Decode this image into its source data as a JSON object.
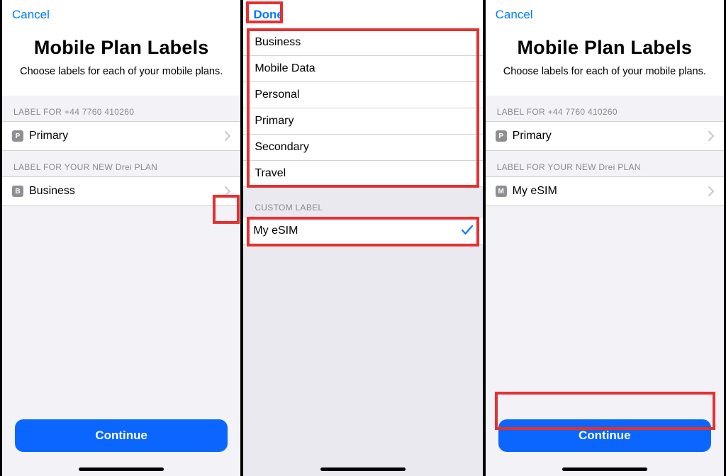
{
  "screen1": {
    "cancel": "Cancel",
    "title": "Mobile Plan Labels",
    "subtitle": "Choose labels for each of your mobile plans.",
    "section1_cap": "LABEL FOR +44 7760 410260",
    "row1_badge": "P",
    "row1_label": "Primary",
    "section2_cap": "LABEL FOR YOUR NEW Drei PLAN",
    "row2_badge": "B",
    "row2_label": "Business",
    "cta": "Continue"
  },
  "screen2": {
    "done": "Done",
    "options": [
      "Business",
      "Mobile Data",
      "Personal",
      "Primary",
      "Secondary",
      "Travel"
    ],
    "custom_cap": "CUSTOM LABEL",
    "custom_value": "My eSIM"
  },
  "screen3": {
    "cancel": "Cancel",
    "title": "Mobile Plan Labels",
    "subtitle": "Choose labels for each of your mobile plans.",
    "section1_cap": "LABEL FOR +44 7760 410260",
    "row1_badge": "P",
    "row1_label": "Primary",
    "section2_cap": "LABEL FOR YOUR NEW Drei PLAN",
    "row2_badge": "M",
    "row2_label": "My eSIM",
    "cta": "Continue"
  }
}
